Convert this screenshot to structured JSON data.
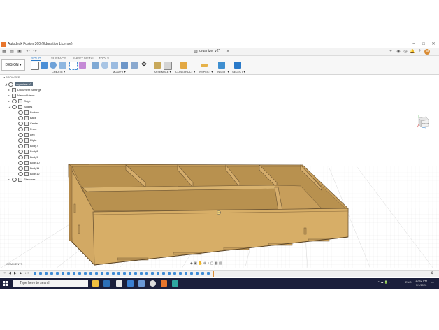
{
  "window": {
    "title": "Autodesk Fusion 360 (Education License)"
  },
  "document_tab": {
    "label": "organizer v2*"
  },
  "workspace": {
    "label": "DESIGN ▾"
  },
  "workspace_tabs": [
    "SOLID",
    "SURFACE",
    "SHEET METAL",
    "TOOLS"
  ],
  "toolbar_groups": [
    "CREATE ▾",
    "MODIFY ▾",
    "ASSEMBLE ▾",
    "CONSTRUCT ▾",
    "INSPECT ▾",
    "INSERT ▾",
    "SELECT ▾"
  ],
  "browser": {
    "header": "BROWSER",
    "root": "organizer v2",
    "items": [
      {
        "label": "Document Settings"
      },
      {
        "label": "Named Views"
      },
      {
        "label": "Origin"
      },
      {
        "label": "Bodies"
      }
    ],
    "bodies": [
      "Bottom",
      "Back",
      "Center",
      "Front",
      "Left",
      "Right",
      "Body7",
      "Body8",
      "Body9",
      "Body10",
      "Body11",
      "Body12"
    ],
    "sketches": "Sketches"
  },
  "viewcube": {
    "label": "FRONT"
  },
  "comments": {
    "label": "COMMENTS"
  },
  "taskbar": {
    "search_placeholder": "Type here to search",
    "tray_lang": "ENG",
    "time": "10:42 PM",
    "date": "7/1/2020"
  },
  "colors": {
    "accent": "#2a7ac9",
    "wood": "#cfa560",
    "wood_dark": "#b5894a",
    "taskbar": "#1b1f3b"
  }
}
